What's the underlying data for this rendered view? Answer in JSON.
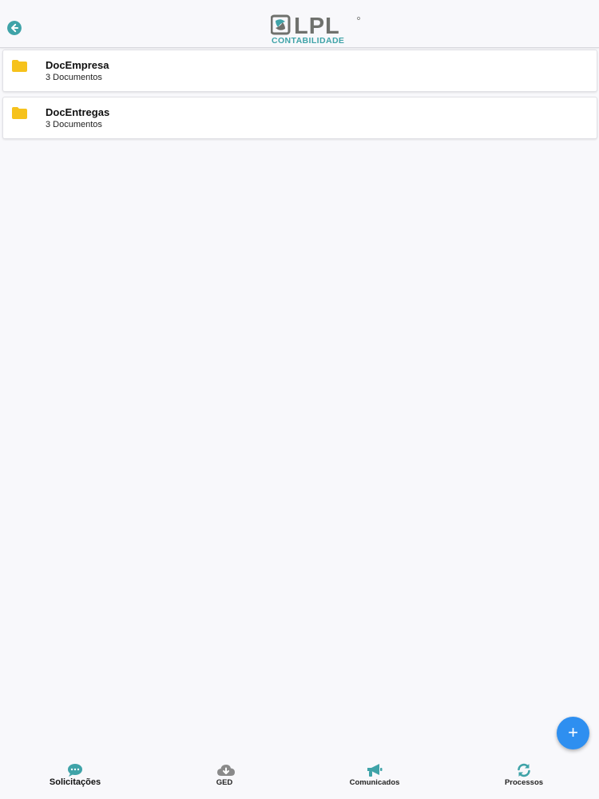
{
  "header": {
    "logo_text": "LPL",
    "logo_subtitle": "CONTABILIDADE",
    "back_icon": "arrow-left-circle-icon"
  },
  "colors": {
    "accent": "#3fa3a8",
    "logo_gray": "#6f716d",
    "folder": "#f6c21c",
    "fab": "#2e8ff0",
    "tab_icon_gray": "#8a8a8a"
  },
  "folders": [
    {
      "title": "DocEmpresa",
      "subtitle": "3 Documentos",
      "icon": "folder-icon"
    },
    {
      "title": "DocEntregas",
      "subtitle": "3 Documentos",
      "icon": "folder-icon"
    }
  ],
  "fab": {
    "label": "+",
    "icon": "plus-icon"
  },
  "tabs": [
    {
      "label": "Solicitações",
      "icon": "chat-bubble-icon",
      "active": true
    },
    {
      "label": "GED",
      "icon": "cloud-download-icon",
      "active": false
    },
    {
      "label": "Comunicados",
      "icon": "megaphone-icon",
      "active": false
    },
    {
      "label": "Processos",
      "icon": "sync-icon",
      "active": false
    }
  ]
}
